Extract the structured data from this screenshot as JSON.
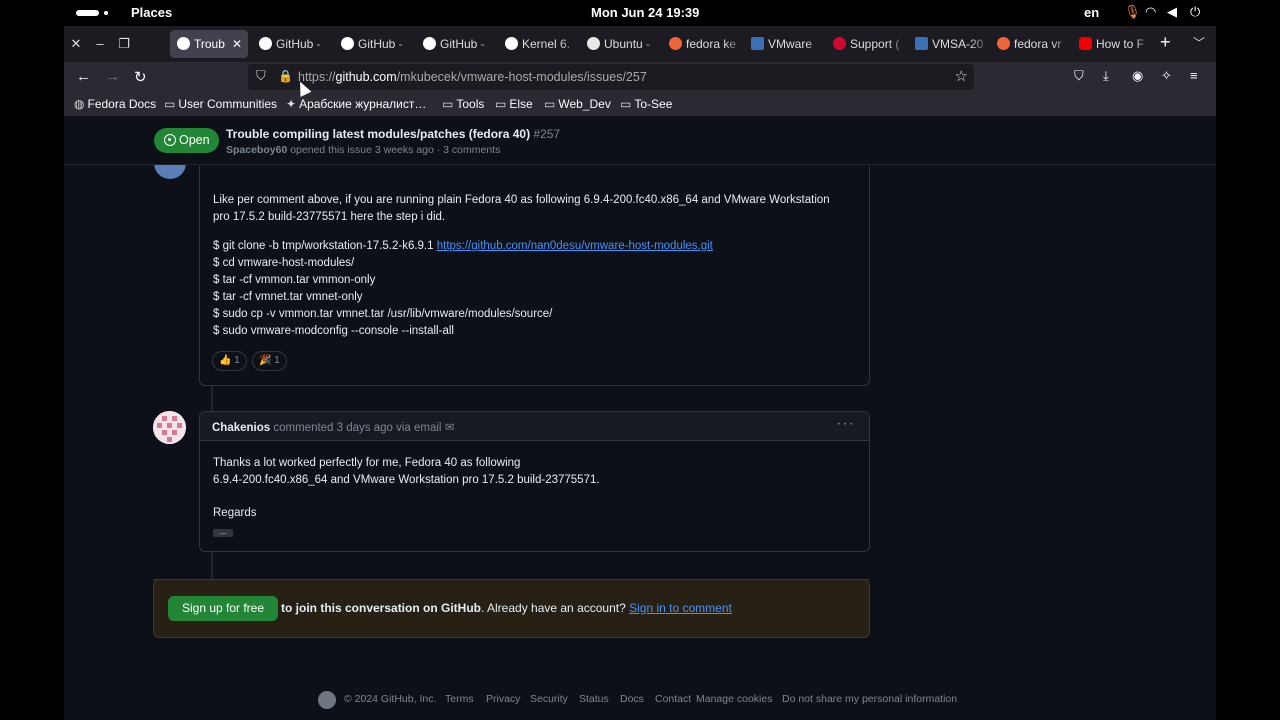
{
  "system_bar": {
    "places": "Places",
    "clock": "Mon Jun 24  19:39",
    "lang": "en"
  },
  "tabs": [
    {
      "label": "Troub",
      "icon": "github-icon",
      "active": true
    },
    {
      "label": "GitHub - ",
      "icon": "github-icon"
    },
    {
      "label": "GitHub - ",
      "icon": "github-icon"
    },
    {
      "label": "GitHub - ",
      "icon": "github-icon"
    },
    {
      "label": "Kernel 6.",
      "icon": "github-icon"
    },
    {
      "label": "Ubuntu - ",
      "icon": "ubuntu-icon"
    },
    {
      "label": "fedora ke",
      "icon": "brave-icon"
    },
    {
      "label": "VMware ",
      "icon": "vmware-icon"
    },
    {
      "label": "Support (",
      "icon": "broadcom-icon"
    },
    {
      "label": "VMSA-20",
      "icon": "vmware-icon"
    },
    {
      "label": "fedora vr",
      "icon": "brave-icon"
    },
    {
      "label": "How to F",
      "icon": "redhat-icon"
    }
  ],
  "url": {
    "prefix": "https://",
    "host": "github.com",
    "path": "/mkubecek/vmware-host-modules/issues/257"
  },
  "bookmarks": [
    {
      "label": "Fedora Docs",
      "icon": "globe-icon"
    },
    {
      "label": "User Communities",
      "icon": "folder-icon"
    },
    {
      "label": "Арабские журналист…",
      "icon": "sparkle-icon"
    },
    {
      "label": "Tools",
      "icon": "folder-icon"
    },
    {
      "label": "Else",
      "icon": "folder-icon"
    },
    {
      "label": "Web_Dev",
      "icon": "folder-icon"
    },
    {
      "label": "To-See",
      "icon": "folder-icon"
    }
  ],
  "issue": {
    "state": "Open",
    "title": "Trouble compiling latest modules/patches (fedora 40)",
    "number": "#257",
    "author": "Spaceboy60",
    "meta": "opened this issue 3 weeks ago · 3 comments"
  },
  "comment1": {
    "line1": "Like per comment above, if you are running plain Fedora 40 as following 6.9.4-200.fc40.x86_64 and VMware Workstation",
    "line2": "pro 17.5.2 build-23775571 here the step i did.",
    "cmd1_prefix": "$ git clone -b tmp/workstation-17.5.2-k6.9.1 ",
    "cmd1_link": "https://github.com/nan0desu/vmware-host-modules.git",
    "cmd2": "$ cd vmware-host-modules/",
    "cmd3": "$ tar -cf vmmon.tar vmmon-only",
    "cmd4": "$ tar -cf vmnet.tar vmnet-only",
    "cmd5": "$ sudo cp -v vmmon.tar vmnet.tar /usr/lib/vmware/modules/source/",
    "cmd6": "$ sudo vmware-modconfig --console --install-all",
    "reaction1_count": "1",
    "reaction2_count": "1"
  },
  "comment2": {
    "author": "Chakenios",
    "meta": " commented 3 days ago via email",
    "line1": "Thanks a lot worked perfectly for me, Fedora 40 as following",
    "line2": "6.9.4-200.fc40.x86_64 and VMware Workstation pro 17.5.2 build-23775571.",
    "regards": "Regards",
    "ellipsis": "..."
  },
  "signup": {
    "button": "Sign up for free",
    "bold": "to join this conversation on GitHub",
    "rest": ". Already have an account? ",
    "link": "Sign in to comment"
  },
  "footer": {
    "copyright": "© 2024 GitHub, Inc.",
    "terms": "Terms",
    "privacy": "Privacy",
    "security": "Security",
    "status": "Status",
    "docs": "Docs",
    "contact": "Contact",
    "cookies": "Manage cookies",
    "dnsmpi": "Do not share my personal information"
  },
  "colors": {
    "page_bg": "#0d1117",
    "open_green": "#238636",
    "link_blue": "#4493f8",
    "border": "#30363d"
  }
}
